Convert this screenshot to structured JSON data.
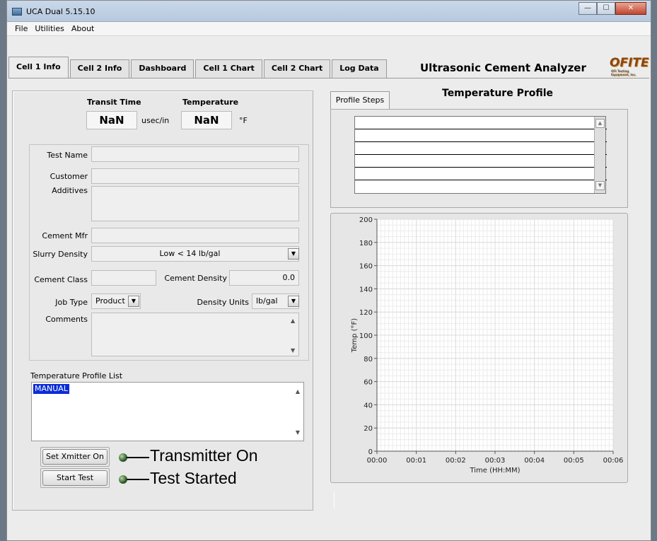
{
  "window": {
    "title": "UCA Dual 5.15.10",
    "controls": {
      "minimize": "—",
      "maximize": "☐",
      "close": "✕"
    }
  },
  "menu": [
    "File",
    "Utilities",
    "About"
  ],
  "tabs": [
    {
      "label": "Cell 1 Info",
      "active": true
    },
    {
      "label": "Cell 2 Info"
    },
    {
      "label": "Dashboard"
    },
    {
      "label": "Cell 1 Chart"
    },
    {
      "label": "Cell 2 Chart"
    },
    {
      "label": "Log Data"
    }
  ],
  "app_heading": "Ultrasonic Cement Analyzer",
  "logo": {
    "text": "OFITE",
    "tagline": "OFI Testing Equipment, Inc."
  },
  "readouts": {
    "transit_time_label": "Transit Time",
    "transit_time_value": "NaN",
    "transit_time_unit": "usec/in",
    "temperature_label": "Temperature",
    "temperature_value": "NaN",
    "temperature_unit": "°F"
  },
  "form": {
    "test_name_label": "Test Name",
    "test_name_value": "",
    "customer_label": "Customer",
    "customer_value": "",
    "additives_label": "Additives",
    "additives_value": "",
    "cement_mfr_label": "Cement Mfr",
    "cement_mfr_value": "",
    "slurry_density_label": "Slurry Density",
    "slurry_density_value": "Low < 14 lb/gal",
    "cement_class_label": "Cement Class",
    "cement_class_value": "",
    "cement_density_label": "Cement Density",
    "cement_density_value": "0.0",
    "job_type_label": "Job Type",
    "job_type_value": "Product",
    "density_units_label": "Density Units",
    "density_units_value": "lb/gal",
    "comments_label": "Comments",
    "comments_value": ""
  },
  "profile_list": {
    "label": "Temperature Profile List",
    "items": [
      "MANUAL"
    ],
    "selected": "MANUAL"
  },
  "controls": {
    "xmitter_button": "Set Xmitter On",
    "start_button": "Start Test",
    "xmitter_indicator": "Transmitter On",
    "test_indicator": "Test Started"
  },
  "profile": {
    "subtab_label": "Profile Steps",
    "title": "Temperature Profile"
  },
  "chart_data": {
    "type": "line",
    "title": "",
    "xlabel": "Time (HH:MM)",
    "ylabel": "Temp (°F)",
    "x_ticks": [
      "00:00",
      "00:01",
      "00:02",
      "00:03",
      "00:04",
      "00:05",
      "00:06"
    ],
    "y_ticks": [
      0,
      20,
      40,
      60,
      80,
      100,
      120,
      140,
      160,
      180,
      200
    ],
    "xlim": [
      0,
      6
    ],
    "ylim": [
      0,
      200
    ],
    "grid": true,
    "series": []
  }
}
